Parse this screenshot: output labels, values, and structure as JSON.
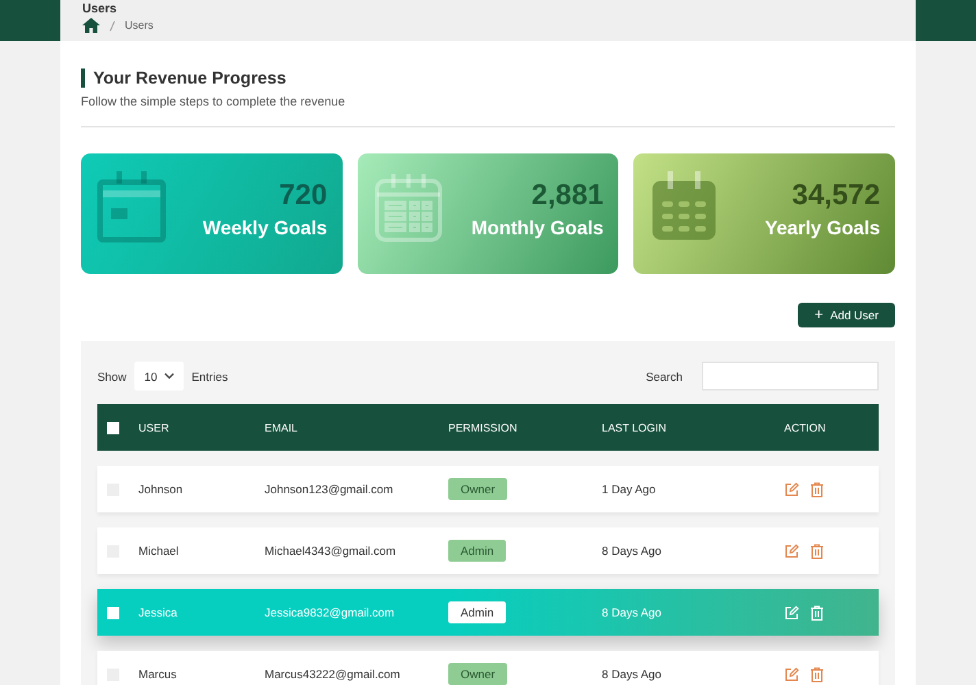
{
  "header": {
    "title": "Users",
    "breadcrumb": [
      "Users"
    ]
  },
  "section": {
    "title": "Your Revenue Progress",
    "subtitle": "Follow the simple steps to complete the revenue"
  },
  "cards": [
    {
      "kind": "week",
      "value": "720",
      "label": "Weekly Goals"
    },
    {
      "kind": "month",
      "value": "2,881",
      "label": "Monthly Goals"
    },
    {
      "kind": "year",
      "value": "34,572",
      "label": "Yearly Goals"
    }
  ],
  "add_button": {
    "icon": "+",
    "label": "Add User"
  },
  "table_controls": {
    "show_label": "Show",
    "entries_value": "10",
    "entries_label": "Entries",
    "search_label": "Search"
  },
  "table": {
    "select_all": {
      "checked": false
    },
    "columns": [
      "USER",
      "EMAIL",
      "PERMISSION",
      "LAST LOGIN",
      "ACTION"
    ],
    "rows": [
      {
        "selected": false,
        "checked": false,
        "user": "Johnson",
        "email": "Johnson123@gmail.com",
        "permission": "Owner",
        "last_login": "1 Day Ago"
      },
      {
        "selected": false,
        "checked": false,
        "user": "Michael",
        "email": "Michael4343@gmail.com",
        "permission": "Admin",
        "last_login": "8 Days Ago"
      },
      {
        "selected": true,
        "checked": false,
        "user": "Jessica",
        "email": "Jessica9832@gmail.com",
        "permission": "Admin",
        "last_login": "8 Days Ago"
      },
      {
        "selected": false,
        "checked": false,
        "user": "Marcus",
        "email": "Marcus43222@gmail.com",
        "permission": "Owner",
        "last_login": "8 Days Ago"
      }
    ]
  }
}
